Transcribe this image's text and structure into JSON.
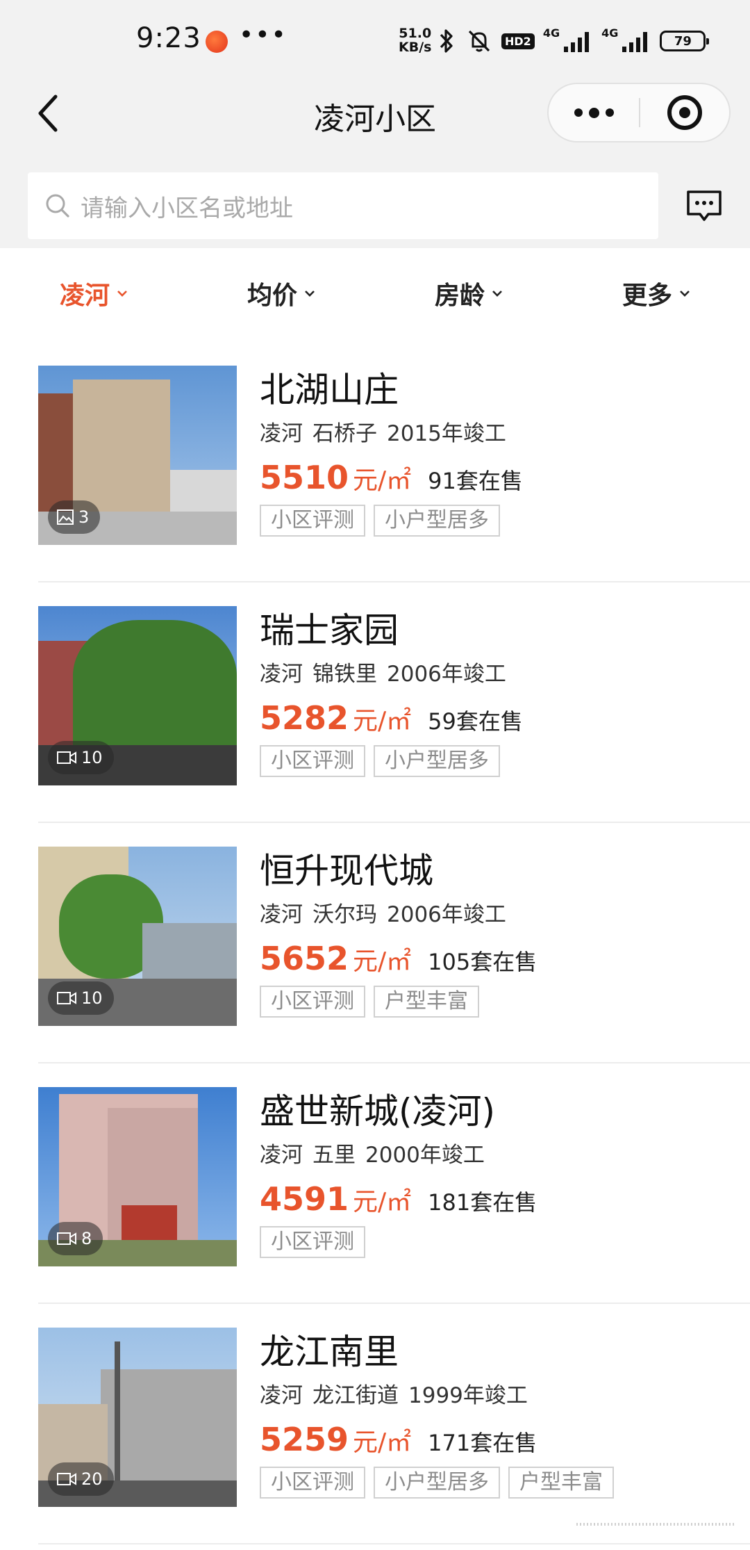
{
  "status_bar": {
    "time": "9:23",
    "menu_dots": "•••",
    "speed_value": "51.0",
    "speed_unit": "KB/s",
    "hd_label": "HD2",
    "net1": "4G",
    "net2": "4G",
    "battery": "79"
  },
  "nav": {
    "title": "凌河小区"
  },
  "search": {
    "placeholder": "请输入小区名或地址"
  },
  "filters": [
    {
      "label": "凌河",
      "active": true
    },
    {
      "label": "均价",
      "active": false
    },
    {
      "label": "房龄",
      "active": false
    },
    {
      "label": "更多",
      "active": false
    }
  ],
  "communities": [
    {
      "name": "北湖山庄",
      "district": "凌河",
      "area": "石桥子",
      "built": "2015年竣工",
      "price": "5510",
      "unit": "元/㎡",
      "on_sale": "91套在售",
      "media_type": "photo",
      "media_count": "3",
      "tags": [
        "小区评测",
        "小户型居多"
      ]
    },
    {
      "name": "瑞士家园",
      "district": "凌河",
      "area": "锦铁里",
      "built": "2006年竣工",
      "price": "5282",
      "unit": "元/㎡",
      "on_sale": "59套在售",
      "media_type": "video",
      "media_count": "10",
      "tags": [
        "小区评测",
        "小户型居多"
      ]
    },
    {
      "name": "恒升现代城",
      "district": "凌河",
      "area": "沃尔玛",
      "built": "2006年竣工",
      "price": "5652",
      "unit": "元/㎡",
      "on_sale": "105套在售",
      "media_type": "video",
      "media_count": "10",
      "tags": [
        "小区评测",
        "户型丰富"
      ]
    },
    {
      "name": "盛世新城(凌河)",
      "district": "凌河",
      "area": "五里",
      "built": "2000年竣工",
      "price": "4591",
      "unit": "元/㎡",
      "on_sale": "181套在售",
      "media_type": "video",
      "media_count": "8",
      "tags": [
        "小区评测"
      ]
    },
    {
      "name": "龙江南里",
      "district": "凌河",
      "area": "龙江街道",
      "built": "1999年竣工",
      "price": "5259",
      "unit": "元/㎡",
      "on_sale": "171套在售",
      "media_type": "video",
      "media_count": "20",
      "tags": [
        "小区评测",
        "小户型居多",
        "户型丰富"
      ]
    }
  ],
  "colors": {
    "accent": "#e8542c",
    "top_background": "#f2f2f2",
    "tag_border": "#d0d0d0"
  }
}
